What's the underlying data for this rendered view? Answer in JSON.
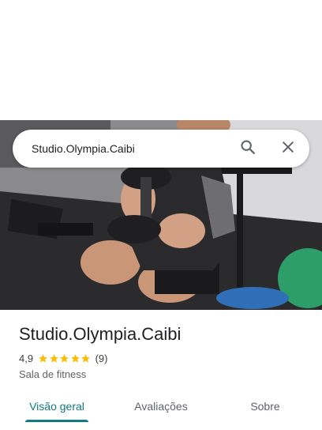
{
  "search": {
    "query": "Studio.Olympia.Caibi",
    "search_icon": "search-icon",
    "close_icon": "close-icon"
  },
  "place": {
    "name": "Studio.Olympia.Caibi",
    "rating": "4,9",
    "stars": 5,
    "review_count": "(9)",
    "category": "Sala de fitness"
  },
  "tabs": [
    {
      "label": "Visão geral",
      "active": true
    },
    {
      "label": "Avaliações",
      "active": false
    },
    {
      "label": "Sobre",
      "active": false
    }
  ],
  "colors": {
    "accent": "#117a7e",
    "star": "#fbbc04",
    "text_primary": "#202124",
    "text_secondary": "#5f6368"
  }
}
